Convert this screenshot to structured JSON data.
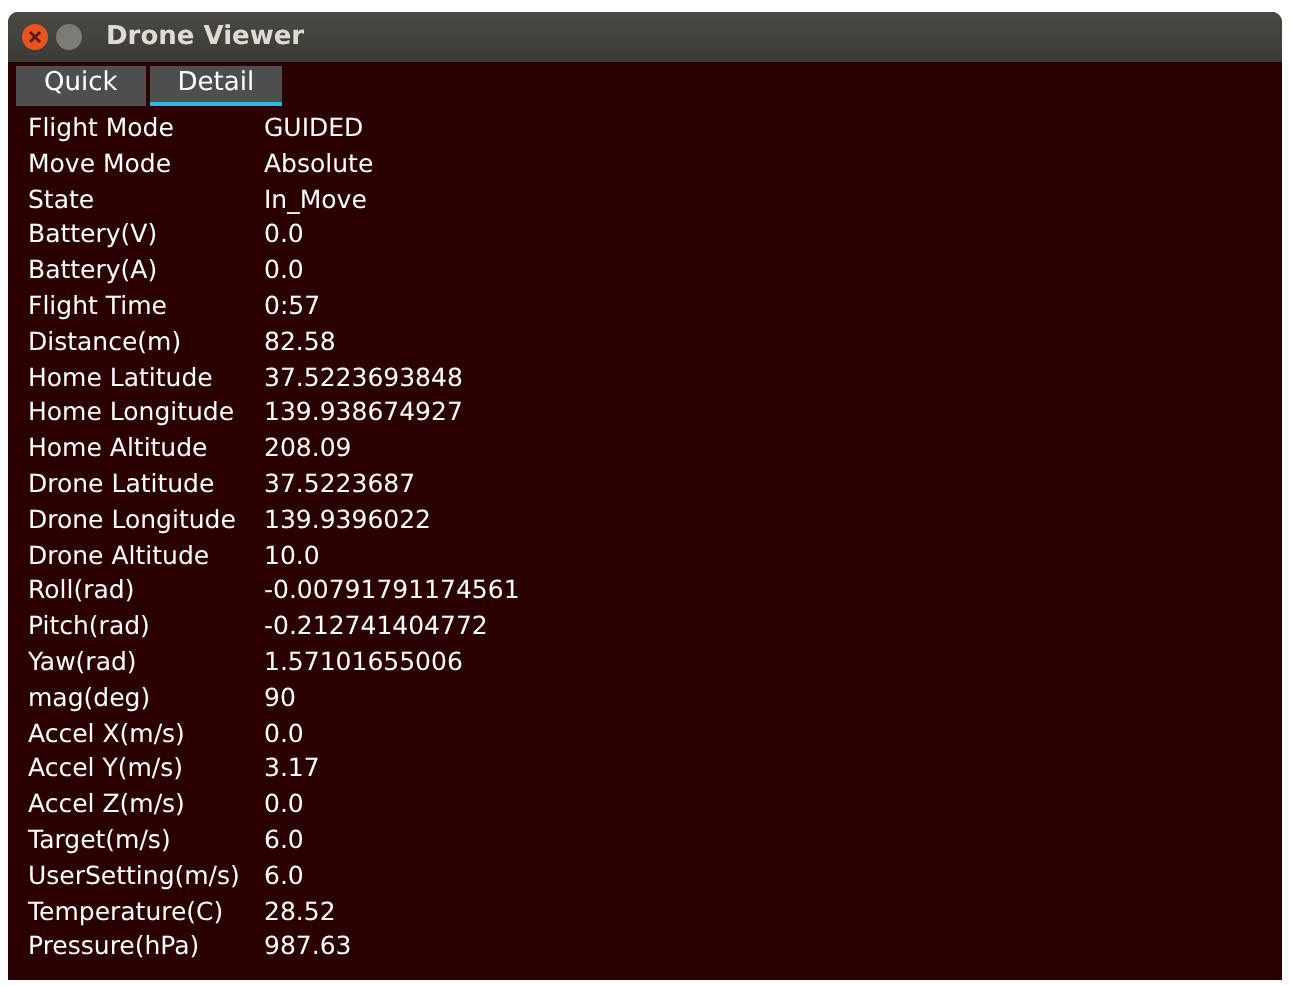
{
  "window": {
    "title": "Drone Viewer"
  },
  "tabs": [
    {
      "label": "Quick",
      "selected": false
    },
    {
      "label": "Detail",
      "selected": true
    }
  ],
  "rows": [
    {
      "label": "Flight Mode",
      "value": "GUIDED"
    },
    {
      "label": "Move Mode",
      "value": "Absolute"
    },
    {
      "label": "State",
      "value": "In_Move"
    },
    {
      "label": "Battery(V)",
      "value": "0.0"
    },
    {
      "label": "Battery(A)",
      "value": "0.0"
    },
    {
      "label": "Flight Time",
      "value": "0:57"
    },
    {
      "label": "Distance(m)",
      "value": "82.58"
    },
    {
      "label": "Home Latitude",
      "value": "37.5223693848"
    },
    {
      "label": "Home Longitude",
      "value": "139.938674927"
    },
    {
      "label": "Home Altitude",
      "value": "208.09"
    },
    {
      "label": "Drone Latitude",
      "value": "37.5223687"
    },
    {
      "label": "Drone Longitude",
      "value": "139.9396022"
    },
    {
      "label": "Drone Altitude",
      "value": "10.0"
    },
    {
      "label": "Roll(rad)",
      "value": "-0.00791791174561"
    },
    {
      "label": "Pitch(rad)",
      "value": "-0.212741404772"
    },
    {
      "label": "Yaw(rad)",
      "value": "1.57101655006"
    },
    {
      "label": "mag(deg)",
      "value": "90"
    },
    {
      "label": "Accel X(m/s)",
      "value": "0.0"
    },
    {
      "label": "Accel Y(m/s)",
      "value": "3.17"
    },
    {
      "label": "Accel Z(m/s)",
      "value": "0.0"
    },
    {
      "label": "Target(m/s)",
      "value": "6.0"
    },
    {
      "label": "UserSetting(m/s)",
      "value": "6.0"
    },
    {
      "label": "Temperature(C)",
      "value": "28.52"
    },
    {
      "label": "Pressure(hPa)",
      "value": "987.63"
    }
  ]
}
